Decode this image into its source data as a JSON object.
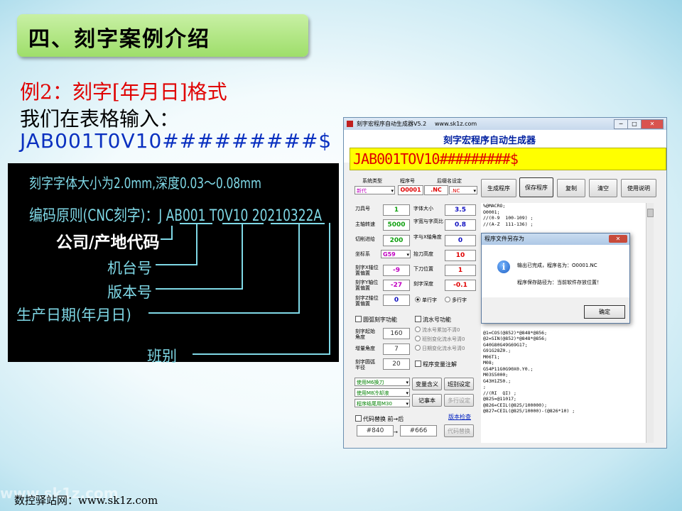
{
  "slide": {
    "title": "四、刻字案例介绍",
    "line1": "例2：刻字[年月日]格式",
    "line2": "我们在表格输入：",
    "line3": "JAB001T0V10#########$",
    "footer": "数控驿站网：www.sk1z.com",
    "watermark": "www.sk1z.com"
  },
  "diagram": {
    "line1": "刻字字体大小为2.0mm,深度0.03～0.08mm",
    "line2": "编码原则(CNC刻字)：J AB001 T0V10 20210322A",
    "label_company": "公司/产地代码",
    "label_machine": "机台号",
    "label_version": "版本号",
    "label_date": "生产日期(年月日)",
    "label_shift": "班别"
  },
  "window": {
    "title": "刻字宏程序自动生成器V5.2",
    "url": "www.sk1z.com",
    "app_title": "刻字宏程序自动生成器",
    "input_value": "JAB001TOV10#########$",
    "system_type_label": "系统类型",
    "program_no_label": "程序号",
    "suffix_label": "后缀名设定",
    "system_type": "新代",
    "program_no": "O0001",
    "suffix1": ".NC",
    "suffix2": ".NC",
    "buttons": {
      "generate": "生成程序",
      "save": "保存程序",
      "copy": "复制",
      "clear": "清空",
      "help": "使用说明",
      "var_meaning": "变量含义",
      "shift_setting": "班别设定",
      "notepad": "记事本",
      "multirow_setting": "多行设定",
      "code_replace": "代码替换"
    },
    "fields": {
      "tool_no_label": "刀具号",
      "tool_no": "1",
      "spindle_label": "主轴转速",
      "spindle": "5000",
      "feed_label": "切削进给",
      "feed": "200",
      "coord_label": "坐标系",
      "coord": "G59",
      "xpos_label": "刻字X轴位置偏置",
      "xpos": "-9",
      "ypos_label": "刻字Y轴位置偏置",
      "ypos": "-27",
      "zpos_label": "刻字Z轴位置偏置",
      "zpos": "0",
      "font_size_label": "字体大小",
      "font_size": "3.5",
      "ratio_label": "字宽与字高比",
      "ratio": "0.8",
      "angle_label": "字与X轴角度",
      "angle": "0",
      "lift_label": "抬刀高度",
      "lift": "10",
      "down_label": "下刀位置",
      "down": "1",
      "depth_label": "刻字深度",
      "depth": "-0.1",
      "single_row": "单行字",
      "multi_row": "多行字"
    },
    "arc": {
      "enable": "圆弧刻字功能",
      "start_angle_label": "刻字起始角度",
      "start_angle": "160",
      "inc_angle_label": "增量角度",
      "inc_angle": "7",
      "radius_label": "刻字圆弧半径",
      "radius": "20"
    },
    "serial": {
      "enable": "流水号功能",
      "opt1": "流水号累加不清0",
      "opt2": "班别变化流水号清0",
      "opt3": "日期变化流水号清0",
      "var_comment": "程序变量注解"
    },
    "dropdowns": {
      "tool_change": "使用M6换刀",
      "coolant": "使用M8冷却液",
      "program_end": "程序结尾用M30"
    },
    "replace": {
      "enable": "代码替换 前→后",
      "version_check": "版本检查",
      "before": "#840",
      "arrow": "→",
      "after": "#666"
    },
    "code_text": "%@MACRO;\nO0001;\n//(0-9  100-109) ;\n//(A-Z  111-136) ;\n\n\n\n\n\n\n\n\n\n\n\n\n\n\n\n\n\n@1=COS(@852)*@848*@856;\n@2=SIN(@852)*@848*@856;\nG40G80G49G69G17;\nG91G28Z0.;\nM06T1;\nM08;\nG54P11G0G90X0.Y0.;\nM03S5000;\nG43H1Z50.;\n;\n//(RI  QI) ;\n@825=@11017;\n@826=CEIL(@825/100000);\n@827=CEIL(@825/10000)-(@826*10) ;",
    "dialog": {
      "title": "程序文件另存为",
      "close": "✕",
      "msg1": "输出已完成，程序名为：O0001.NC",
      "msg2": "程序保存路径为：当前软件存放位置！",
      "ok": "确定"
    }
  }
}
